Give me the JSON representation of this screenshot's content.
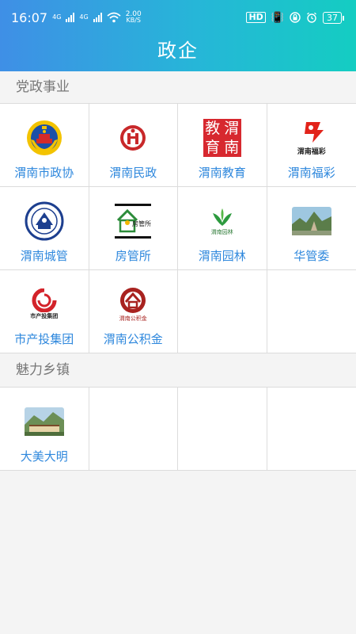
{
  "status": {
    "time": "16:07",
    "net1": "4G",
    "net2": "4G",
    "speed_value": "2.00",
    "speed_unit": "KB/S",
    "hd": "HD",
    "battery": "37"
  },
  "header": {
    "title": "政企"
  },
  "sections": [
    {
      "label": "党政事业",
      "items": [
        {
          "label": "渭南市政协",
          "icon": "cppcc-emblem-icon"
        },
        {
          "label": "渭南民政",
          "icon": "civil-affairs-logo-icon"
        },
        {
          "label": "渭南教育",
          "icon": "education-seal-icon",
          "icon_text": [
            "教",
            "渭",
            "育",
            "南"
          ]
        },
        {
          "label": "渭南福彩",
          "icon": "welfare-lottery-logo-icon",
          "icon_text": "渭南福彩"
        },
        {
          "label": "渭南城管",
          "icon": "urban-management-badge-icon"
        },
        {
          "label": "房管所",
          "icon": "housing-office-logo-icon",
          "icon_text": "房管所"
        },
        {
          "label": "渭南园林",
          "icon": "gardens-logo-icon",
          "icon_text": "渭南园林"
        },
        {
          "label": "华管委",
          "icon": "mountain-photo-icon"
        },
        {
          "label": "市产投集团",
          "icon": "investment-group-logo-icon",
          "icon_text": "市产投集团"
        },
        {
          "label": "渭南公积金",
          "icon": "housing-fund-logo-icon",
          "icon_text": "渭南公积金"
        }
      ]
    },
    {
      "label": "魅力乡镇",
      "items": [
        {
          "label": "大美大明",
          "icon": "town-landscape-photo-icon"
        }
      ]
    }
  ],
  "colors": {
    "accent": "#2f88dd",
    "header_start": "#3f8fe6",
    "header_end": "#14cdc2"
  }
}
